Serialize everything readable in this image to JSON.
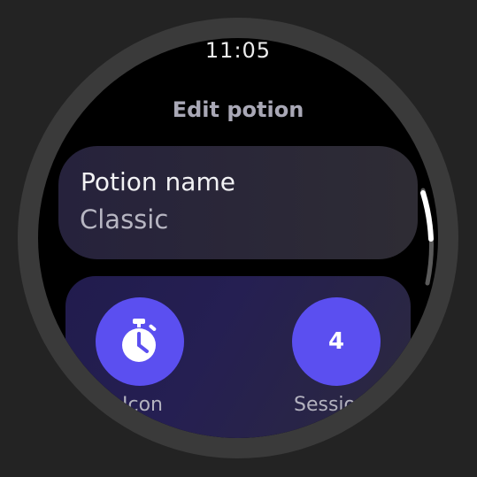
{
  "status_bar": {
    "time": "11:05"
  },
  "screen": {
    "title": "Edit potion"
  },
  "potion_name": {
    "label": "Potion name",
    "value": "Classic"
  },
  "chips": {
    "icon": {
      "label": "Icon",
      "icon": "stopwatch-icon"
    },
    "sessions": {
      "label": "Sessions",
      "value": "4"
    }
  },
  "colors": {
    "accent": "#5b4ff0",
    "background": "#000000",
    "card": "#2e2c34",
    "scrollbar_thumb": "#ffffff",
    "scrollbar_track": "#5a5a5a"
  },
  "scroll": {
    "position": 0.0
  }
}
